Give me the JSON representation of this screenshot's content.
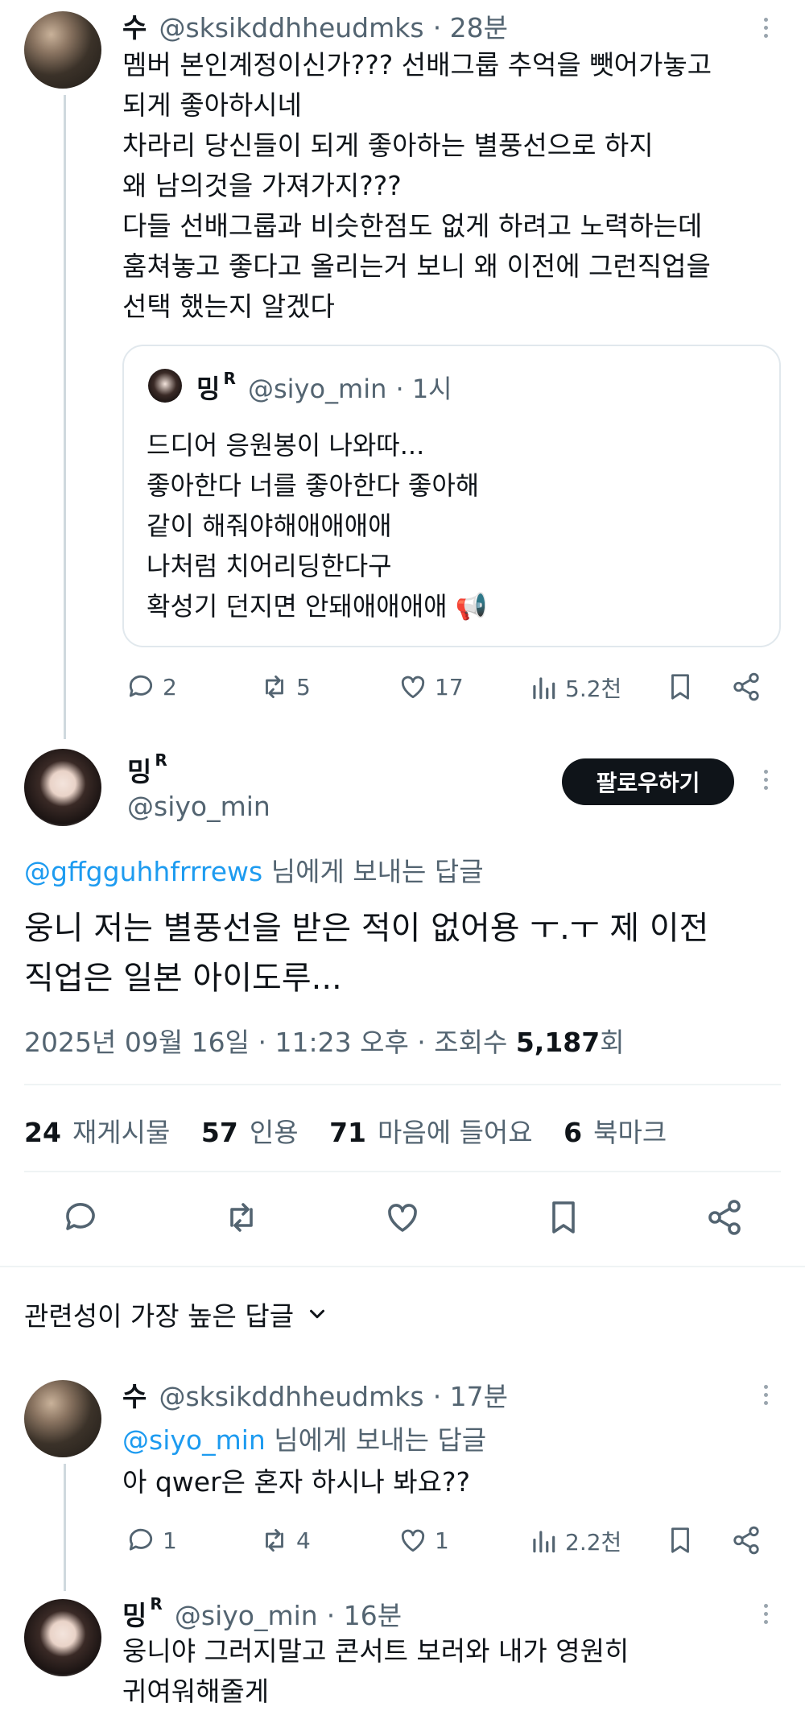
{
  "tweet1": {
    "name": "수",
    "handle": "@sksikddhheudmks",
    "time": "· 28분",
    "lines": [
      "멤버 본인계정이신가??? 선배그룹 추억을 뺏어가놓고",
      "되게 좋아하시네",
      "차라리 당신들이 되게 좋아하는 별풍선으로 하지",
      "왜 남의것을 가져가지???",
      "다들 선배그룹과 비슷한점도 없게 하려고 노력하는데",
      "훔쳐놓고 좋다고 올리는거 보니 왜 이전에 그런직업을",
      "선택 했는지 알겠다"
    ],
    "quote": {
      "name": "밍",
      "badge": "R",
      "handle": "@siyo_min",
      "time": "· 1시",
      "lines": [
        "드디어 응원봉이 나와따...",
        "좋아한다 너를 좋아한다 좋아해",
        "같이 해줘야해애애애애",
        "나처럼 치어리딩한다구",
        "확성기 던지면 안돼애애애애 📢"
      ]
    },
    "actions": {
      "replies": "2",
      "retweets": "5",
      "likes": "17",
      "views": "5.2천"
    }
  },
  "main_tweet": {
    "name": "밍",
    "badge": "R",
    "handle": "@siyo_min",
    "follow_label": "팔로우하기",
    "reply_to_handle": "@gffgguhhfrrrews",
    "reply_to_suffix": " 님에게 보내는 답글",
    "lines": [
      "웅니 저는 별풍선을 받은 적이 없어용 ㅜ.ㅜ 제 이전",
      "직업은 일본 아이도루..."
    ],
    "meta_prefix": "2025년 09월 16일 · 11:23 오후 · 조회수 ",
    "meta_views": "5,187",
    "meta_suffix": "회",
    "stats": [
      {
        "num": "24",
        "label": "재게시물"
      },
      {
        "num": "57",
        "label": "인용"
      },
      {
        "num": "71",
        "label": "마음에 들어요"
      },
      {
        "num": "6",
        "label": "북마크"
      }
    ]
  },
  "sort": {
    "label": "관련성이 가장 높은 답글"
  },
  "reply1": {
    "name": "수",
    "handle": "@sksikddhheudmks",
    "time": "· 17분",
    "reply_to_handle": "@siyo_min",
    "reply_to_suffix": " 님에게 보내는 답글",
    "text": "아 qwer은 혼자 하시나 봐요??",
    "actions": {
      "replies": "1",
      "retweets": "4",
      "likes": "1",
      "views": "2.2천"
    }
  },
  "reply2": {
    "name": "밍",
    "badge": "R",
    "handle": "@siyo_min",
    "time": "· 16분",
    "lines": [
      "웅니야 그러지말고 콘서트 보러와 내가 영원히",
      "귀여워해줄게"
    ]
  }
}
